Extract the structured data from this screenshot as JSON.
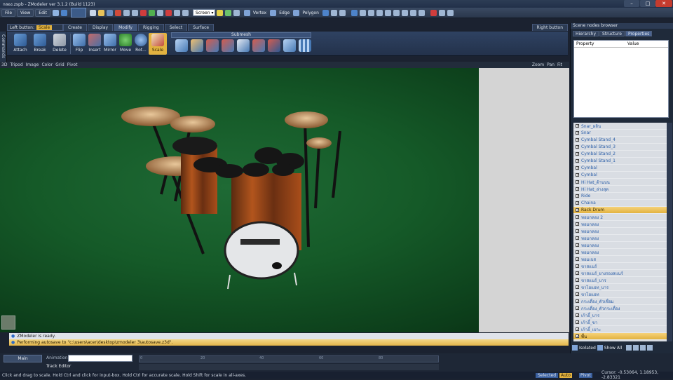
{
  "window": {
    "title": "กลอง.zspb - ZModeler ver 3.1.2 (Build 1123)"
  },
  "menu": {
    "items": [
      "File",
      "View",
      "Edit"
    ]
  },
  "toolbar": {
    "view_combo": "Screen",
    "select_modes": [
      "Vertex",
      "Edge",
      "Polygon"
    ]
  },
  "mode_bar": {
    "left_button": "Left button:",
    "left_button_value": "Scale",
    "tabs": [
      "Create",
      "Display",
      "Modify",
      "Rigging",
      "Select",
      "Surface"
    ],
    "right_button": "Right button"
  },
  "ribbon": {
    "tools": [
      "Attach",
      "Break",
      "Delete",
      "Flip",
      "Insert",
      "Mirror",
      "Move",
      "Rot...",
      "Scale"
    ],
    "group_label": "Submesh"
  },
  "left_strip": {
    "label": "Commands"
  },
  "viewport_bar": {
    "left_items": [
      "3D",
      "Tripod",
      "Image",
      "Color",
      "Grid",
      "Pivot"
    ],
    "right_items": [
      "Zoom",
      "Pan",
      "Fit"
    ]
  },
  "side_panel": {
    "title": "Scene nodes browser",
    "tabs": [
      "Hierarchy",
      "Structure",
      "Properties"
    ],
    "prop_headers": [
      "Property",
      "Value"
    ]
  },
  "scene_nodes": {
    "items": [
      {
        "label": "Snar_ผลิน",
        "checked": true,
        "selected": false
      },
      {
        "label": "Snar",
        "checked": true,
        "selected": false
      },
      {
        "label": "Cymbal Stand_4",
        "checked": true,
        "selected": false
      },
      {
        "label": "Cymbal Stand_3",
        "checked": true,
        "selected": false
      },
      {
        "label": "Cymbal Stand_2",
        "checked": true,
        "selected": false
      },
      {
        "label": "Cymbal Stand_1",
        "checked": true,
        "selected": false
      },
      {
        "label": "Cymbal",
        "checked": true,
        "selected": false
      },
      {
        "label": "Cymbal",
        "checked": true,
        "selected": false
      },
      {
        "label": "Hi Hat_ด้านบน",
        "checked": true,
        "selected": false
      },
      {
        "label": "Hi Hat_ล่างสุด",
        "checked": true,
        "selected": false
      },
      {
        "label": "Ride",
        "checked": true,
        "selected": false
      },
      {
        "label": "Chaina",
        "checked": true,
        "selected": false
      },
      {
        "label": "Rack Drum",
        "checked": true,
        "selected": true
      },
      {
        "label": "ทอมกลอง 2",
        "checked": true,
        "selected": false
      },
      {
        "label": "ทอมกลอง",
        "checked": true,
        "selected": false
      },
      {
        "label": "ทอมกลอง",
        "checked": true,
        "selected": false
      },
      {
        "label": "ทอมกลอง",
        "checked": true,
        "selected": false
      },
      {
        "label": "ทอมกลอง",
        "checked": true,
        "selected": false
      },
      {
        "label": "ทอมกลอง",
        "checked": true,
        "selected": false
      },
      {
        "label": "ทอมเบส",
        "checked": true,
        "selected": false
      },
      {
        "label": "ขาสแนร์",
        "checked": true,
        "selected": false
      },
      {
        "label": "ขาสแนร์_ยางรองสแนร์",
        "checked": true,
        "selected": false
      },
      {
        "label": "ขาสแนร์_บาร",
        "checked": true,
        "selected": false
      },
      {
        "label": "ขาไฮแฮท_บาร",
        "checked": true,
        "selected": false
      },
      {
        "label": "ขาไฮแฮท",
        "checked": true,
        "selected": false
      },
      {
        "label": "กระเดื่อง_ตัวเชื่อม",
        "checked": true,
        "selected": false
      },
      {
        "label": "กระเดื่อง_ตัวกระเดื่อง",
        "checked": true,
        "selected": false
      },
      {
        "label": "เก้าอี้_บาร",
        "checked": true,
        "selected": false
      },
      {
        "label": "เก้าอี้_ขา",
        "checked": true,
        "selected": false
      },
      {
        "label": "เก้าอี้_เบาะ",
        "checked": true,
        "selected": false
      },
      {
        "label": "พื้น",
        "checked": true,
        "selected": true
      }
    ]
  },
  "side_bottom": {
    "isolated": "Isolated",
    "show_all": "Show All"
  },
  "log": {
    "lines": [
      "ZModeler is ready.",
      "Performing autosave to \"c:\\users\\acer\\desktop\\zmodeler 3\\autosave.z3d\"."
    ]
  },
  "timeline": {
    "main_button": "Main",
    "animation_label": "Animation:",
    "track_editor": "Track Editor",
    "ticks": [
      "0",
      "20",
      "40",
      "60",
      "80"
    ]
  },
  "status": {
    "hint": "Click and drag to scale. Hold Ctrl and click for input-box. Hold Ctrl for accurate scale. Hold Shift for scale in all-axes.",
    "selected": "Selected",
    "auto": "Auto",
    "pivot": "Pivot",
    "cursor": "Cursor: -0.53064, 1.18953, -2.83321"
  },
  "colors": {
    "accent": "#e2b240",
    "viewport_green": "#155a28",
    "chrome": "#2a374c"
  }
}
